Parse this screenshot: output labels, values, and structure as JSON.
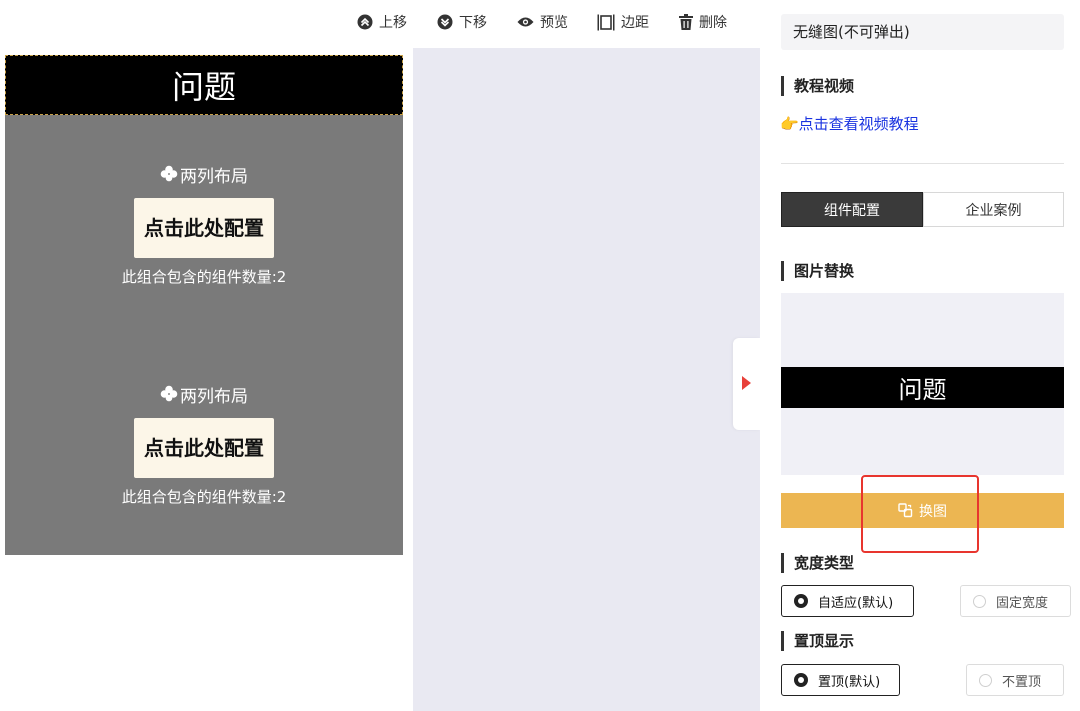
{
  "toolbar": {
    "move_up": "上移",
    "move_down": "下移",
    "preview": "预览",
    "margin": "边距",
    "delete": "删除"
  },
  "canvas": {
    "header_title": "问题",
    "blocks": [
      {
        "title": "两列布局",
        "button": "点击此处配置",
        "count_text": "此组合包含的组件数量:2"
      },
      {
        "title": "两列布局",
        "button": "点击此处配置",
        "count_text": "此组合包含的组件数量:2"
      }
    ]
  },
  "panel": {
    "component_name": "无缝图(不可弹出)",
    "tutorial_title": "教程视频",
    "tutorial_link": "👉点击查看视频教程",
    "tabs": {
      "active": "组件配置",
      "inactive": "企业案例"
    },
    "image_section_title": "图片替换",
    "image_preview_text": "问题",
    "replace_button": "换图",
    "width_type_title": "宽度类型",
    "width_options": {
      "selected": "自适应(默认)",
      "other": "固定宽度"
    },
    "sticky_title": "置顶显示",
    "sticky_options": {
      "selected": "置顶(默认)",
      "other": "不置顶"
    }
  },
  "colors": {
    "accent_button": "#ecb652",
    "highlight": "#e8352e",
    "link": "#1a33e0",
    "collapse_arrow": "#e8403a"
  }
}
